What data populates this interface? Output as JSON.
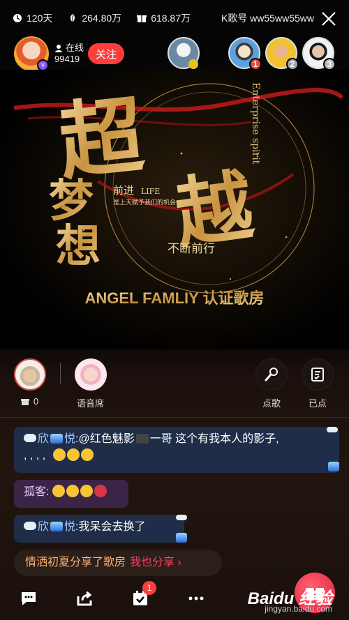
{
  "status": {
    "days": "120天",
    "stat2": "264.80万",
    "stat3": "618.87万",
    "room_id": "K歌号 ww55ww55ww"
  },
  "host": {
    "online_label": "在线",
    "online_count": "99419",
    "follow_label": "关注"
  },
  "ranking": [
    {
      "rank": "",
      "color": "#e8c020"
    },
    {
      "rank": "1",
      "color": "#e84a3a"
    },
    {
      "rank": "2",
      "color": "#9aa4b0"
    },
    {
      "rank": "3",
      "color": "#b8b8b8"
    }
  ],
  "banner": {
    "big_top": "超",
    "big_mid": "越",
    "side_1": "梦",
    "side_2": "想",
    "english": "Enterprise spirit",
    "progress": "前进",
    "life": "LIFE",
    "tagline": "是上天赋予我们的机会",
    "forward": "不断前行",
    "caption": "ANGEL FAMLIY 认证歌房"
  },
  "seats": {
    "gift_count": "0",
    "voice_seat_label": "语音席",
    "request_song_label": "点歌",
    "ordered_label": "已点"
  },
  "chat": [
    {
      "name": "欣",
      "name2": "悦",
      "text": ":@红色魅影",
      "text2": "一哥 这个有我本人的影子,",
      "text3": ", , , ,"
    },
    {
      "name": "孤客",
      "text": ":"
    },
    {
      "name": "欣",
      "name2": "悦",
      "text": ":我呆会去换了"
    }
  ],
  "share": {
    "text": "情洒初夏分享了歌房",
    "link": "我也分享 ›"
  },
  "toolbar": {
    "badge": "1"
  },
  "watermark": {
    "brand": "Baidu 经验",
    "url": "jingyan.baidu.com"
  },
  "colors": {
    "accent": "#ff3d3d",
    "gold": "#e2b761",
    "chat_bubble": "#1f2d48"
  }
}
